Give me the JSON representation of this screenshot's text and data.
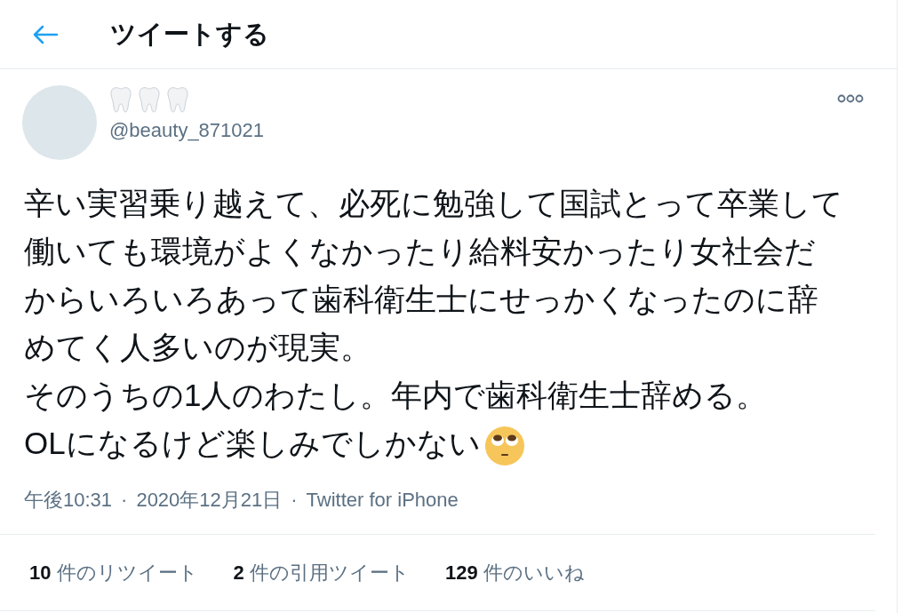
{
  "header": {
    "title": "ツイートする"
  },
  "tweet": {
    "handle": "@beauty_871021",
    "paragraphs": [
      "辛い実習乗り越えて、必死に勉強して国試とって卒業して働いても環境がよくなかったり給料安かったり女社会だからいろいろあって歯科衛生士にせっかくなったのに辞めてく人多いのが現実。",
      "そのうちの1人のわたし。年内で歯科衛生士辞める。",
      "OLになるけど楽しみでしかない"
    ],
    "time": "午後10:31",
    "date": "2020年12月21日",
    "source": "Twitter for iPhone",
    "separator": "·"
  },
  "stats": [
    {
      "count": "10",
      "label": "件のリツイート"
    },
    {
      "count": "2",
      "label": "件の引用ツイート"
    },
    {
      "count": "129",
      "label": "件のいいね"
    }
  ]
}
